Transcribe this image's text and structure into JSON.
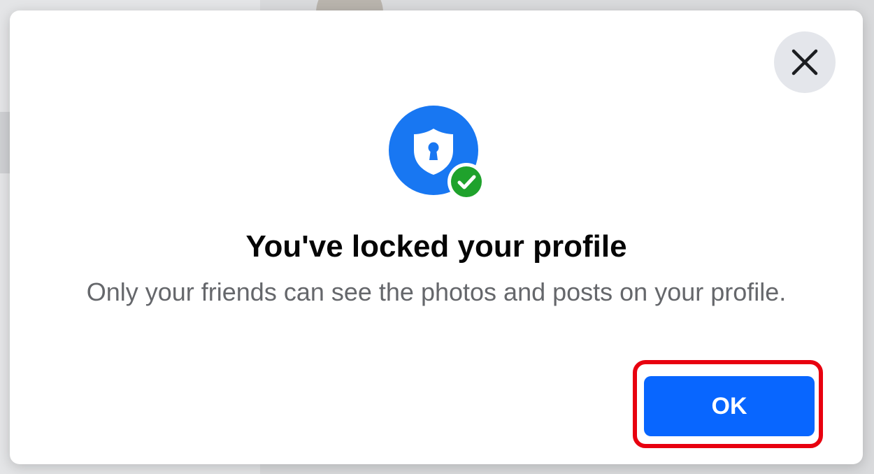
{
  "dialog": {
    "title": "You've locked your profile",
    "message": "Only your friends can see the photos and posts on your profile.",
    "ok_label": "OK",
    "icons": {
      "close": "close-icon",
      "shield": "shield-lock-icon",
      "check": "check-circle-icon"
    }
  },
  "colors": {
    "brand_blue": "#1877f2",
    "button_blue": "#0866ff",
    "success_green": "#1fa22c",
    "highlight_red": "#e8000f",
    "title_text": "#050505",
    "secondary_text": "#65676b"
  }
}
